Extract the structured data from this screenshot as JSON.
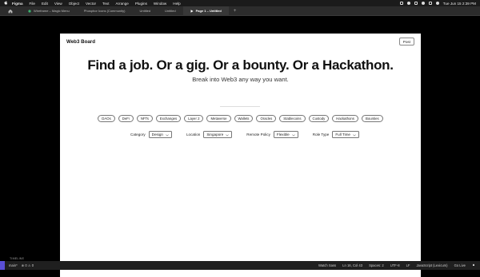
{
  "menubar": {
    "app": "Figma",
    "items": [
      "File",
      "Edit",
      "View",
      "Object",
      "Vector",
      "Text",
      "Arrange",
      "Plugins",
      "Window",
      "Help"
    ],
    "clock": "Tue Jun 15  2:39 PM"
  },
  "tabs": [
    {
      "label": "Wireframe – Magic Menu",
      "active": false
    },
    {
      "label": "Phosphor Icons (Community)",
      "active": false
    },
    {
      "label": "Untitled",
      "active": false
    },
    {
      "label": "Untitled",
      "active": false
    },
    {
      "label": "Page 1 – Untitled",
      "active": true
    }
  ],
  "tab_plus": "+",
  "page": {
    "brand": "Web3 Board",
    "post_label": "Post",
    "headline": "Find a job. Or a gig. Or a bounty. Or a Hackathon.",
    "subline": "Break into Web3 any way you want.",
    "tags": [
      "DAOs",
      "DeFi",
      "NFTs",
      "Exchanges",
      "Layer 2",
      "Metaverse",
      "Wallets",
      "Oracles",
      "Stablecoins",
      "Custody",
      "Hackathons",
      "Bounties"
    ],
    "filters": [
      {
        "label": "Category",
        "value": "Design"
      },
      {
        "label": "Location",
        "value": "Singapore"
      },
      {
        "label": "Remote Policy",
        "value": "Flexible"
      },
      {
        "label": "Role Type",
        "value": "Full Time"
      }
    ]
  },
  "statusbar": {
    "timeline": "TIMELINE",
    "branch": "main*",
    "counts": "⊗ 0 ⚠ 0",
    "watch": "Watch Sass",
    "position": "Ln 16, Col 43",
    "spaces": "Spaces: 2",
    "encoding": "UTF-8",
    "eol": "LF",
    "language": "JavaScript (Lexicum)",
    "golive": "Go Live"
  },
  "colors": {
    "menubar": "#1b1b1b",
    "tabbar": "#2c2c2c",
    "canvas": "#000000",
    "page": "#ffffff",
    "statusbar": "#1f1f1f",
    "remote_accent": "#5a4fd6"
  }
}
